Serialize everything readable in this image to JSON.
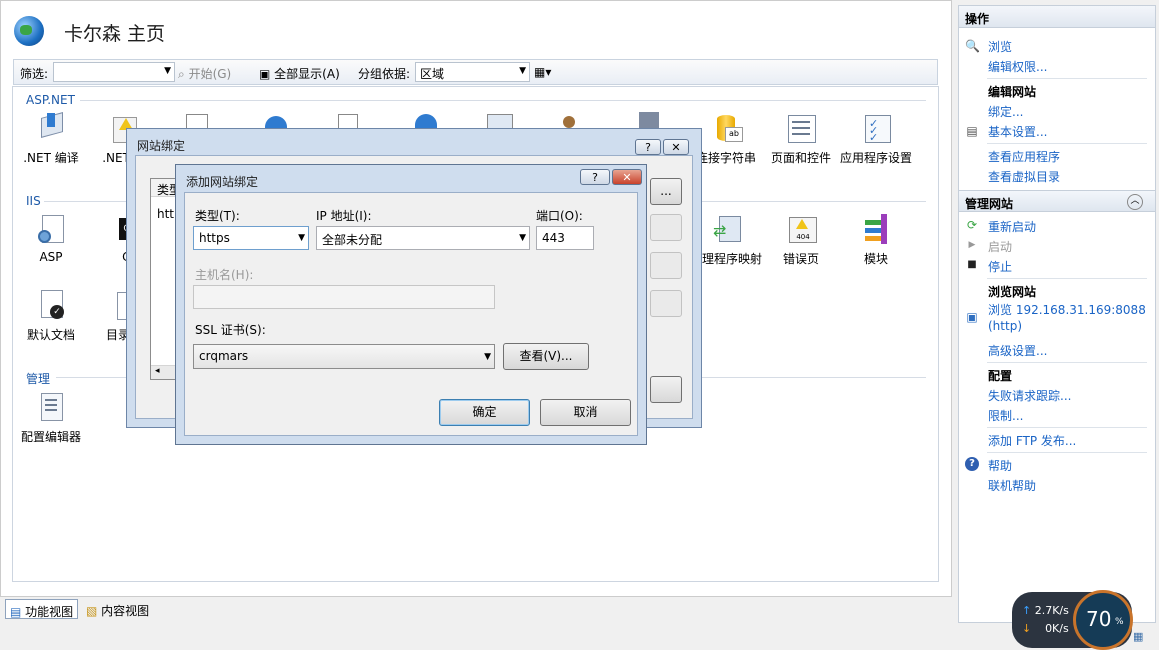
{
  "main": {
    "title": "卡尔森 主页",
    "toolbar": {
      "filter_label": "筛选:",
      "start_label": "开始(G)",
      "show_all_label": "全部显示(A)",
      "group_by_label": "分组依据:",
      "group_by_value": "区域"
    },
    "sections": {
      "aspnet": "ASP.NET",
      "iis": "IIS",
      "manage": "管理"
    },
    "features": {
      "net_compile": ".NET 编译",
      "net_error": ".NET 错",
      "conn_strings": "连接字符串",
      "pages_controls": "页面和控件",
      "app_settings": "应用程序设置",
      "asp": "ASP",
      "cgi": "CG",
      "handler_mappings": "处理程序映射",
      "error_pages": "错误页",
      "modules": "模块",
      "default_doc": "默认文档",
      "dir_browse": "目录",
      "config_editor": "配置编辑器"
    }
  },
  "bindings_dialog": {
    "title": "网站绑定",
    "column_type": "类型",
    "row_type": "http"
  },
  "add_binding_dialog": {
    "title": "添加网站绑定",
    "type_label": "类型(T):",
    "type_value": "https",
    "ip_label": "IP 地址(I):",
    "ip_value": "全部未分配",
    "port_label": "端口(O):",
    "port_value": "443",
    "host_label": "主机名(H):",
    "host_value": "",
    "ssl_label": "SSL 证书(S):",
    "ssl_value": "crqmars",
    "view_button": "查看(V)...",
    "ok_button": "确定",
    "cancel_button": "取消"
  },
  "actions": {
    "header": "操作",
    "browse": "浏览",
    "edit_permissions": "编辑权限...",
    "edit_site_head": "编辑网站",
    "bindings": "绑定...",
    "basic_settings": "基本设置...",
    "view_apps": "查看应用程序",
    "view_vdirs": "查看虚拟目录",
    "manage_site_head": "管理网站",
    "restart": "重新启动",
    "start": "启动",
    "stop": "停止",
    "browse_site_head": "浏览网站",
    "browse_url_1": "浏览 192.168.31.169:8088",
    "browse_url_2": "(http)",
    "advanced_settings": "高级设置...",
    "config_head": "配置",
    "failed_req": "失败请求跟踪...",
    "limits": "限制...",
    "add_ftp": "添加 FTP 发布...",
    "help": "帮助",
    "online_help": "联机帮助"
  },
  "bottom": {
    "features_view": "功能视图",
    "content_view": "内容视图"
  },
  "netwidget": {
    "upload": "2.7K/s",
    "download": "0K/s",
    "percent": "70",
    "percent_unit": "%"
  },
  "colors": {
    "link": "#1a64c6",
    "section": "#1e5aa8",
    "gauge_ring": "#c9742b"
  }
}
